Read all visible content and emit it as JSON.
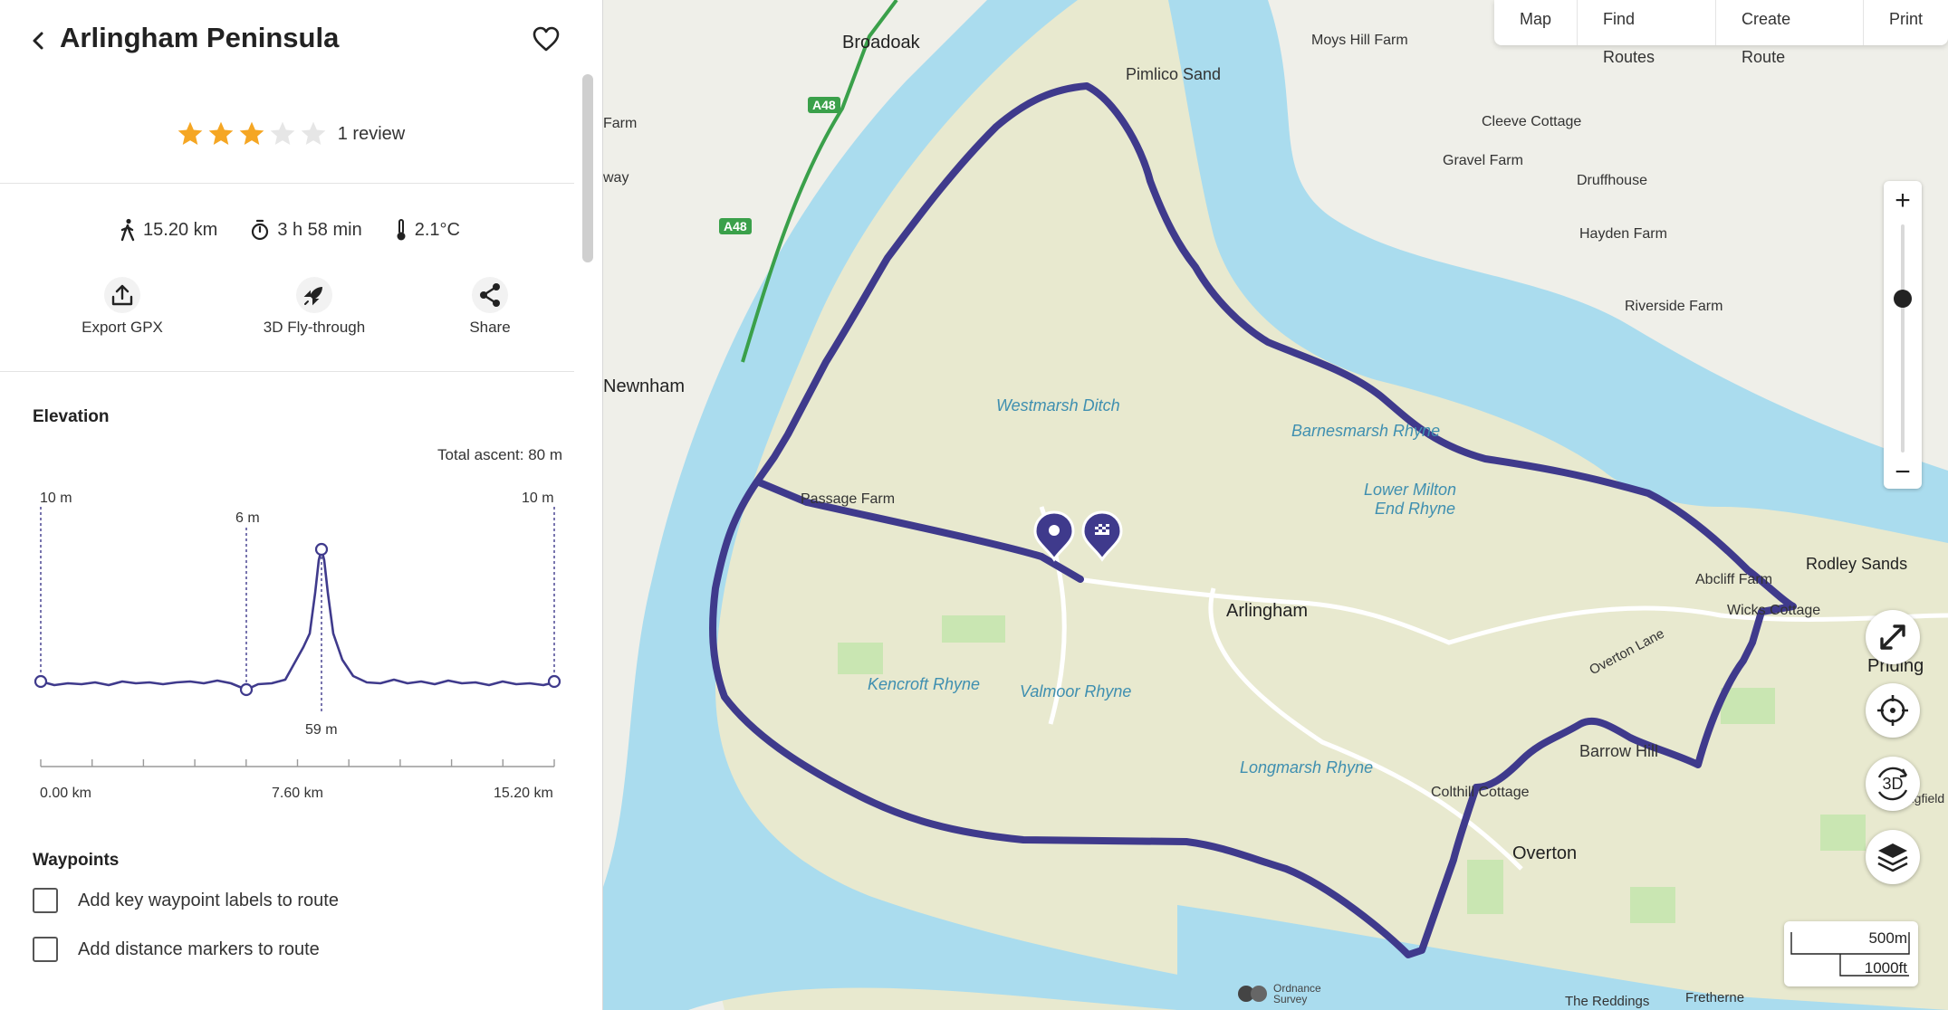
{
  "header": {
    "title": "Arlingham Peninsula"
  },
  "rating": {
    "value": 3,
    "max": 5,
    "reviews_label": "1 review"
  },
  "stats": {
    "distance": "15.20 km",
    "duration": "3 h 58 min",
    "temperature": "2.1°C"
  },
  "actions": {
    "export": "Export GPX",
    "flythrough": "3D Fly-through",
    "share": "Share"
  },
  "elevation": {
    "title": "Elevation",
    "total_ascent": "Total ascent: 80 m",
    "labels": {
      "start": "10 m",
      "mid": "6 m",
      "end": "10 m",
      "peak": "59 m"
    },
    "xaxis": {
      "start": "0.00 km",
      "mid": "7.60 km",
      "end": "15.20 km"
    }
  },
  "waypoints": {
    "title": "Waypoints",
    "options": [
      {
        "label": "Add key waypoint labels to route",
        "checked": false
      },
      {
        "label": "Add distance markers to route",
        "checked": false
      }
    ]
  },
  "topnav": [
    "Map",
    "Find Routes",
    "Create Route",
    "Print"
  ],
  "zoom": {
    "plus": "+",
    "minus": "−",
    "level_fraction": 0.7
  },
  "controls": {
    "threed": "3D"
  },
  "scale": {
    "metric": "500m",
    "imperial": "1000ft"
  },
  "map_labels": {
    "broadoak": "Broadoak",
    "pimlico": "Pimlico Sand",
    "moys": "Moys Hill Farm",
    "cleeve": "Cleeve Cottage",
    "gravel": "Gravel Farm",
    "druff": "Druffhouse",
    "hayden": "Hayden Farm",
    "riverside": "Riverside Farm",
    "newnham": "Newnham",
    "farm": "Farm",
    "way": "way",
    "westmarsh": "Westmarsh Ditch",
    "barnesmarsh": "Barnesmarsh Rhyne",
    "lowermilton1": "Lower Milton",
    "lowermilton2": "End Rhyne",
    "passage": "Passage Farm",
    "rodley": "Rodley Sands",
    "abcliff": "Abcliff Farm",
    "wicks": "Wicks Cottage",
    "priding": "Priding",
    "arlingham": "Arlingham",
    "overtonlane": "Overton Lane",
    "kencroft": "Kencroft Rhyne",
    "valmoor": "Valmoor Rhyne",
    "barrow": "Barrow Hill",
    "longmarsh": "Longmarsh Rhyne",
    "colthill": "Colthill Cottage",
    "overton": "Overton",
    "springfield": "Springfield",
    "reddings": "The Reddings",
    "fretherne": "Fretherne",
    "ordnance": "Ordnance Survey",
    "a48a": "A48",
    "a48b": "A48"
  },
  "colors": {
    "route": "#3f3a8c",
    "water": "#aadcee",
    "sand": "#e8e9cf",
    "land": "#efefe9",
    "star": "#f5a623",
    "green": "#c9e6b2"
  }
}
